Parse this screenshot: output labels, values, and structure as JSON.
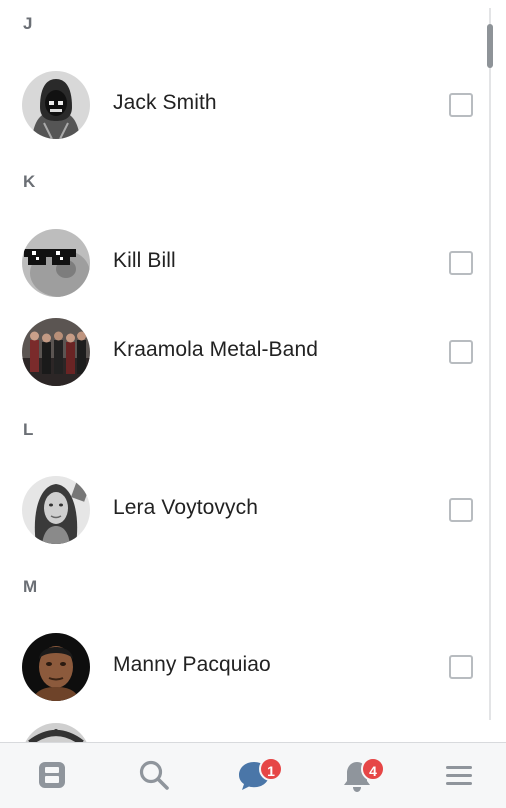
{
  "contacts": {
    "sections": [
      {
        "letter": "J",
        "items": [
          {
            "name": "Jack Smith",
            "checked": false,
            "avatar": "hooded-figure-avatar"
          }
        ]
      },
      {
        "letter": "K",
        "items": [
          {
            "name": "Kill Bill",
            "checked": false,
            "avatar": "pixel-sunglasses-avatar"
          },
          {
            "name": "Kraamola Metal-Band",
            "checked": false,
            "avatar": "band-photo-avatar"
          }
        ]
      },
      {
        "letter": "L",
        "items": [
          {
            "name": "Lera Voytovych",
            "checked": false,
            "avatar": "woman-portrait-avatar"
          }
        ]
      },
      {
        "letter": "M",
        "items": [
          {
            "name": "Manny Pacquiao",
            "checked": false,
            "avatar": "man-portrait-avatar"
          }
        ]
      }
    ]
  },
  "tabbar": {
    "items": [
      {
        "icon": "news-icon",
        "label": ""
      },
      {
        "icon": "search-icon",
        "label": ""
      },
      {
        "icon": "messages-icon",
        "badge": "1",
        "active": true
      },
      {
        "icon": "notifications-icon",
        "badge": "4"
      },
      {
        "icon": "menu-icon",
        "label": ""
      }
    ]
  },
  "colors": {
    "accent": "#4a76a8",
    "badge": "#e64646",
    "section_header": "#6b6f75"
  }
}
